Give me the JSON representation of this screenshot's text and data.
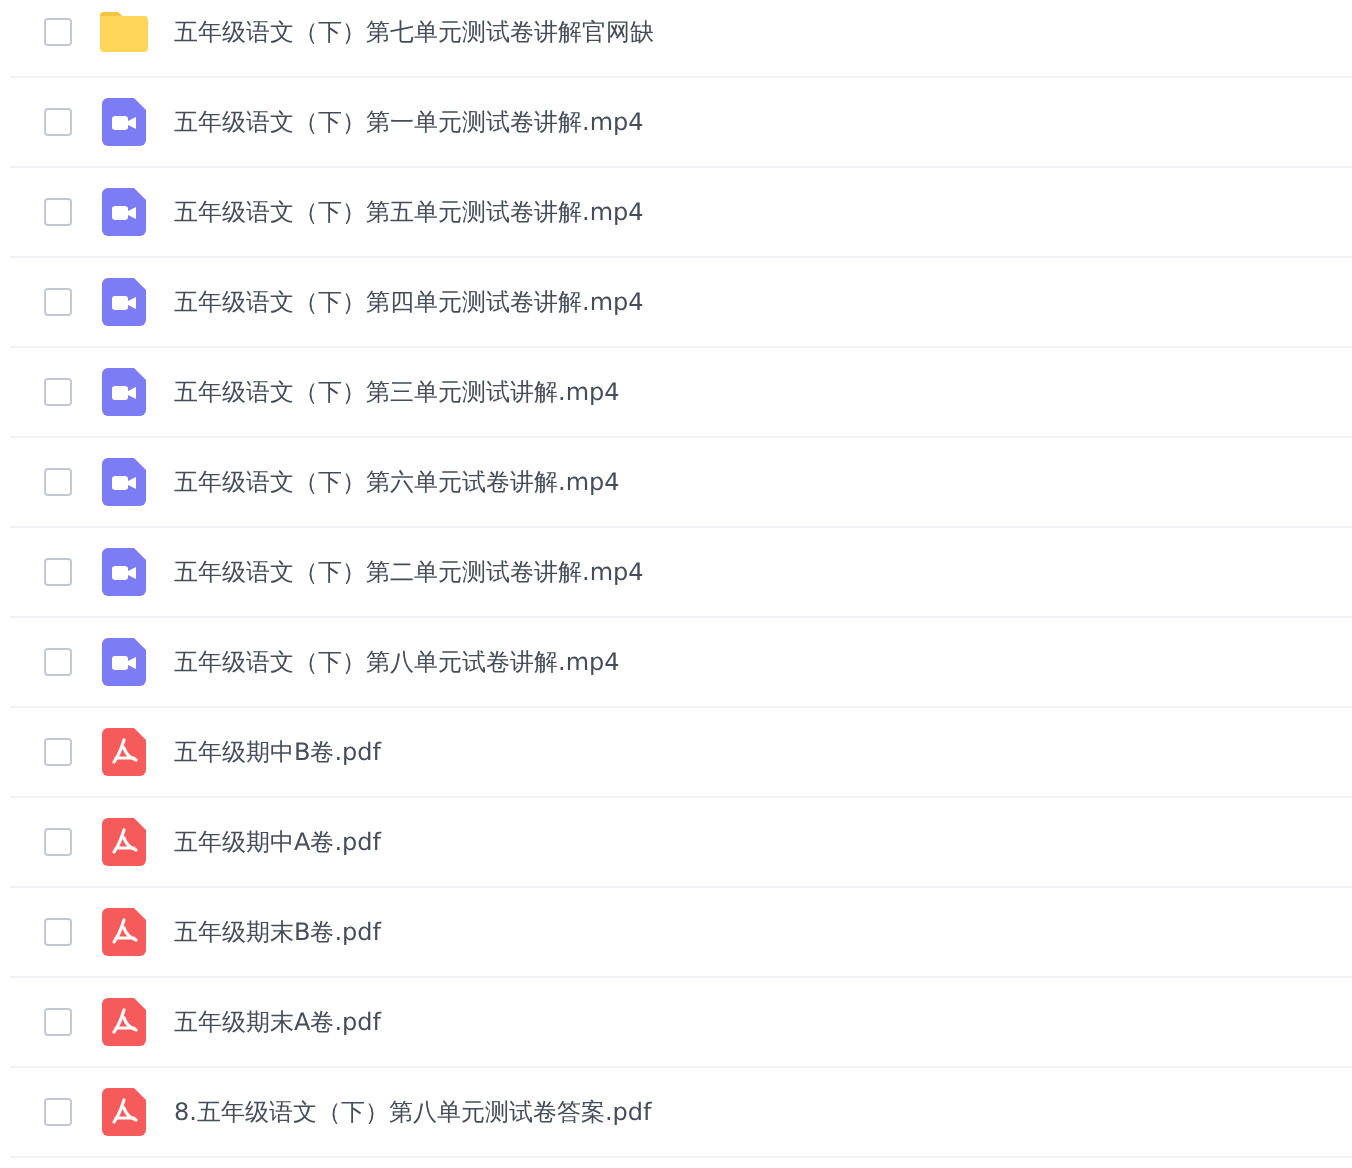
{
  "files": [
    {
      "kind": "folder",
      "name": "五年级语文（下）第七单元测试卷讲解官网缺",
      "checked": false
    },
    {
      "kind": "video",
      "name": "五年级语文（下）第一单元测试卷讲解.mp4",
      "checked": false
    },
    {
      "kind": "video",
      "name": "五年级语文（下）第五单元测试卷讲解.mp4",
      "checked": false
    },
    {
      "kind": "video",
      "name": "五年级语文（下）第四单元测试卷讲解.mp4",
      "checked": false
    },
    {
      "kind": "video",
      "name": "五年级语文（下）第三单元测试讲解.mp4",
      "checked": false
    },
    {
      "kind": "video",
      "name": "五年级语文（下）第六单元试卷讲解.mp4",
      "checked": false
    },
    {
      "kind": "video",
      "name": "五年级语文（下）第二单元测试卷讲解.mp4",
      "checked": false
    },
    {
      "kind": "video",
      "name": "五年级语文（下）第八单元试卷讲解.mp4",
      "checked": false
    },
    {
      "kind": "pdf",
      "name": "五年级期中B卷.pdf",
      "checked": false
    },
    {
      "kind": "pdf",
      "name": "五年级期中A卷.pdf",
      "checked": false
    },
    {
      "kind": "pdf",
      "name": "五年级期末B卷.pdf",
      "checked": false
    },
    {
      "kind": "pdf",
      "name": "五年级期末A卷.pdf",
      "checked": false
    },
    {
      "kind": "pdf",
      "name": "8.五年级语文（下）第八单元测试卷答案.pdf",
      "checked": false
    }
  ]
}
